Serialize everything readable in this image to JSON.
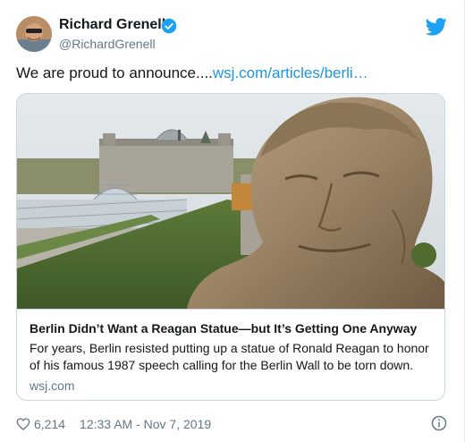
{
  "author": {
    "name": "Richard Grenell",
    "handle": "@RichardGrenell",
    "verified": true
  },
  "tweet": {
    "text_prefix": "We are proud to announce....",
    "link_text": "wsj.com/articles/berli…"
  },
  "card": {
    "title": "Berlin Didn’t Want a Reagan Statue—but It’s Getting One Anyway",
    "description_line1": "For years, Berlin resisted putting up a statue of Ronald Reagan to honor",
    "description_line2": "of his famous 1987 speech calling for the Berlin Wall to be torn down.",
    "domain": "wsj.com"
  },
  "footer": {
    "likes": "6,214",
    "timestamp": "12:33 AM - Nov 7, 2019"
  },
  "colors": {
    "link": "#1b95e0",
    "verified": "#1da1f2",
    "secondary_text": "#657786",
    "border": "#ccd6dd"
  },
  "icons": [
    "verified-badge-icon",
    "twitter-bird-icon",
    "heart-icon",
    "info-icon"
  ]
}
